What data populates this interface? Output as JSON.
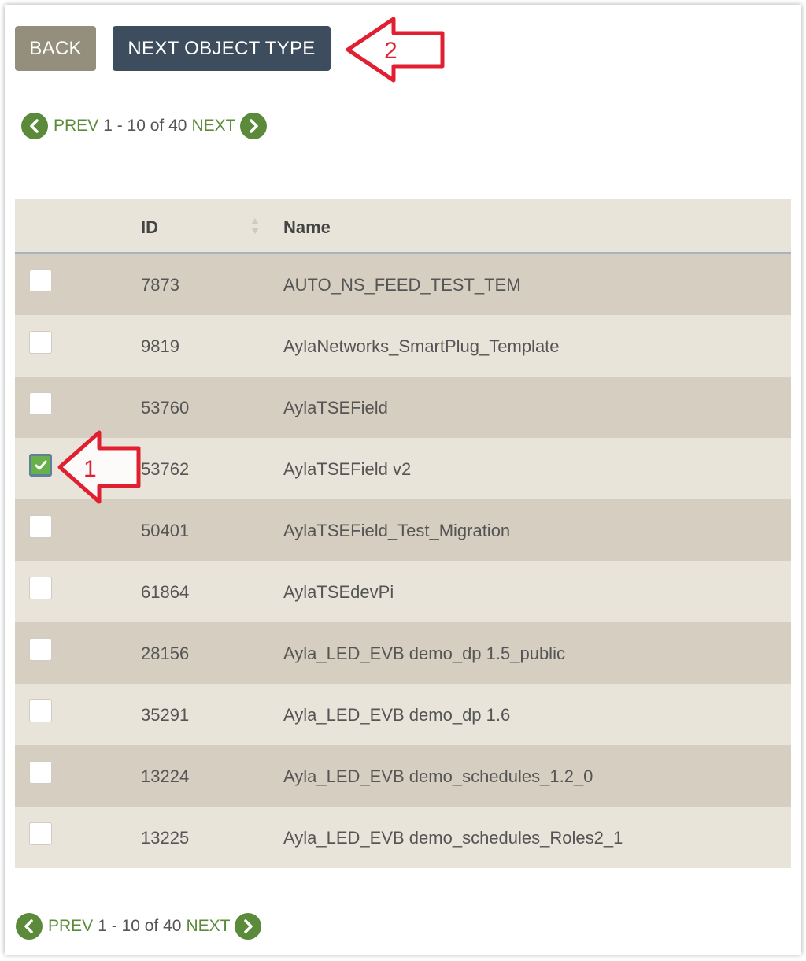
{
  "toolbar": {
    "back_label": "BACK",
    "next_type_label": "NEXT OBJECT TYPE"
  },
  "pager": {
    "prev": "PREV",
    "range": "1 - 10 of 40",
    "next": "NEXT"
  },
  "table": {
    "columns": {
      "id": "ID",
      "name": "Name"
    },
    "rows": [
      {
        "id": "7873",
        "name": "AUTO_NS_FEED_TEST_TEM",
        "checked": false
      },
      {
        "id": "9819",
        "name": "AylaNetworks_SmartPlug_Template",
        "checked": false
      },
      {
        "id": "53760",
        "name": "AylaTSEField",
        "checked": false
      },
      {
        "id": "53762",
        "name": "AylaTSEField v2",
        "checked": true
      },
      {
        "id": "50401",
        "name": "AylaTSEField_Test_Migration",
        "checked": false
      },
      {
        "id": "61864",
        "name": "AylaTSEdevPi",
        "checked": false
      },
      {
        "id": "28156",
        "name": "Ayla_LED_EVB demo_dp 1.5_public",
        "checked": false
      },
      {
        "id": "35291",
        "name": "Ayla_LED_EVB demo_dp 1.6",
        "checked": false
      },
      {
        "id": "13224",
        "name": "Ayla_LED_EVB demo_schedules_1.2_0",
        "checked": false
      },
      {
        "id": "13225",
        "name": "Ayla_LED_EVB demo_schedules_Roles2_1",
        "checked": false
      }
    ]
  },
  "annotations": {
    "arrow1_label": "1",
    "arrow2_label": "2",
    "color": "#e02030"
  },
  "colors": {
    "back_button": "#948f7d",
    "next_button": "#3d4d5e",
    "pager_green": "#5b8a3a",
    "row_dark": "#d6cfc1",
    "row_light": "#e9e4da",
    "checkbox_checked": "#68b04a"
  },
  "icons": {
    "prev": "chevron-left-circle-icon",
    "next": "chevron-right-circle-icon",
    "sort": "sort-icon",
    "check": "check-icon"
  }
}
